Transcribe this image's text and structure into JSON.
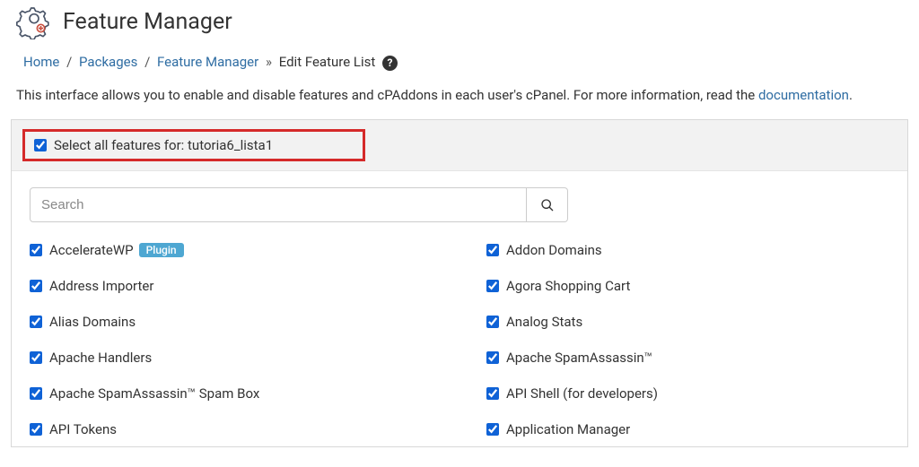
{
  "header": {
    "title": "Feature Manager"
  },
  "breadcrumb": {
    "home": "Home",
    "packages": "Packages",
    "feature_manager": "Feature Manager",
    "edit_label": "Edit Feature List"
  },
  "intro": {
    "text_before_link": "This interface allows you to enable and disable features and cPAddons in each user's cPanel. For more information, read the ",
    "link_text": "documentation",
    "text_after_link": "."
  },
  "select_all": {
    "label": "Select all features for: tutoria6_lista1"
  },
  "search": {
    "placeholder": "Search"
  },
  "badges": {
    "plugin": "Plugin"
  },
  "features_left": [
    "AccelerateWP",
    "Address Importer",
    "Alias Domains",
    "Apache Handlers",
    "Apache SpamAssassin™ Spam Box",
    "API Tokens"
  ],
  "features_right": [
    "Addon Domains",
    "Agora Shopping Cart",
    "Analog Stats",
    "Apache SpamAssassin™",
    "API Shell (for developers)",
    "Application Manager"
  ]
}
